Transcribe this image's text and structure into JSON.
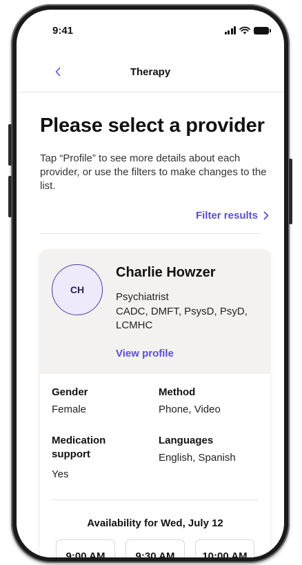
{
  "status_bar": {
    "time": "9:41"
  },
  "nav": {
    "back_icon": "chevron-left-icon",
    "title": "Therapy"
  },
  "page": {
    "title": "Please select a provider",
    "intro": "Tap “Profile” to see more details about each provider, or use the filters to make changes to the list.",
    "filter_label": "Filter results",
    "filter_icon": "chevron-right-icon"
  },
  "provider": {
    "initials": "CH",
    "name": "Charlie Howzer",
    "role": "Psychiatrist",
    "credentials": "CADC, DMFT, PsysD, PsyD, LCMHC",
    "view_profile_label": "View profile",
    "gender_label": "Gender",
    "gender_value": "Female",
    "method_label": "Method",
    "method_value": "Phone, Video",
    "medication_label": "Medication support",
    "medication_value": "Yes",
    "languages_label": "Languages",
    "languages_value": "English, Spanish"
  },
  "availability": {
    "title": "Availability for Wed, July 12",
    "slots": [
      "9:00 AM",
      "9:30 AM",
      "10:00 AM"
    ]
  },
  "colors": {
    "accent": "#5a4fd1",
    "avatar_fill": "#efeafb",
    "avatar_border": "#4d3aa6",
    "card_header_bg": "#f3f2f1"
  }
}
